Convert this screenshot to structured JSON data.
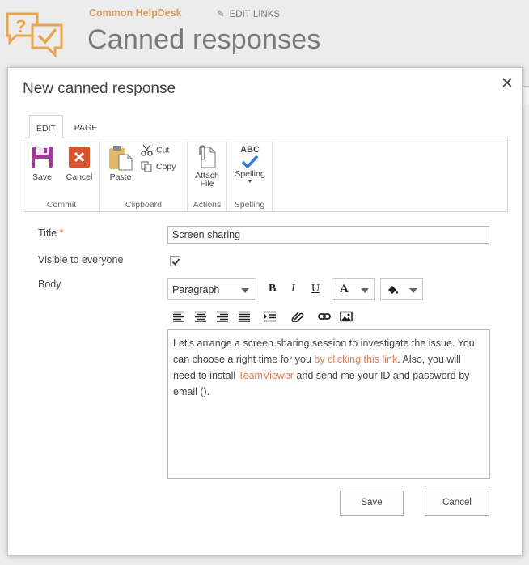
{
  "background": {
    "site_name": "Common HelpDesk",
    "edit_links": "EDIT LINKS",
    "page_title": "Canned responses"
  },
  "dialog": {
    "title": "New canned response",
    "close": "✕"
  },
  "ribbon": {
    "tabs": [
      {
        "label": "EDIT",
        "active": true
      },
      {
        "label": "PAGE",
        "active": false
      }
    ],
    "groups": {
      "commit": {
        "label": "Commit",
        "save": "Save",
        "cancel": "Cancel"
      },
      "clipboard": {
        "label": "Clipboard",
        "paste": "Paste",
        "cut": "Cut",
        "copy": "Copy"
      },
      "actions": {
        "label": "Actions",
        "attach_line1": "Attach",
        "attach_line2": "File"
      },
      "spelling": {
        "label": "Spelling",
        "spelling": "Spelling",
        "abc": "ABC"
      }
    }
  },
  "form": {
    "title_label": "Title",
    "required_mark": "*",
    "title_value": "Screen sharing",
    "visible_label": "Visible to everyone",
    "visible_checked": true,
    "body_label": "Body",
    "toolbar": {
      "format": "Paragraph",
      "bold": "B",
      "italic": "I",
      "underline": "U",
      "font_color": "A"
    },
    "body": {
      "part1": "Let's arrange a screen sharing session to investigate the issue. You can choose a right time for you ",
      "link1": "by clicking this link",
      "part2": ". Also, you will need to install ",
      "link2": "TeamViewer",
      "part3": " and send me your ID and password by email ()."
    }
  },
  "buttons": {
    "save": "Save",
    "cancel": "Cancel"
  },
  "colors": {
    "accent": "#d69d5c",
    "link": "#e07a5a",
    "save_icon": "#a4379a",
    "cancel_icon": "#d9532c",
    "spell_check": "#2b7bd4"
  }
}
